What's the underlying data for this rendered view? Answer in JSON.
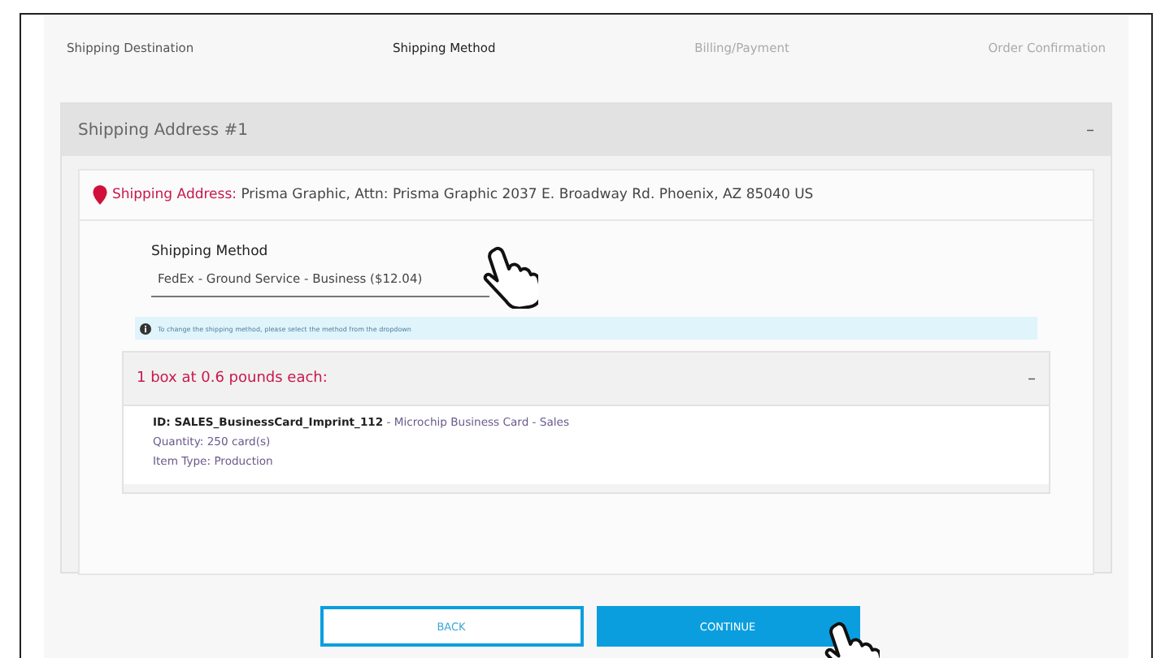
{
  "steps": [
    {
      "label": "Shipping Destination",
      "selected": false,
      "completed": true
    },
    {
      "label": "Shipping Method",
      "selected": true,
      "completed": false
    },
    {
      "label": "Billing/Payment",
      "selected": false,
      "completed": false
    },
    {
      "label": "Order Confirmation",
      "selected": false,
      "completed": false
    }
  ],
  "address_panel": {
    "title": "Shipping Address #1",
    "toggle": "–",
    "address_label": "Shipping Address:",
    "address": "Prisma Graphic, Attn: Prisma Graphic 2037 E. Broadway Rd. Phoenix, AZ 85040 US",
    "method_label": "Shipping Method",
    "method_value": "FedEx - Ground Service - Business ($12.04)",
    "info": "To change the shipping method, please select the method from the dropdown",
    "box": {
      "title": "1 box at 0.6 pounds each:",
      "toggle": "–",
      "item": "**ID: SALES_BusinessCard_Imprint_112** - Microchip Business Card - Sales",
      "quantity": "Quantity: 250 card(s)",
      "item_type": "Item Type: Production"
    }
  },
  "buttons": [
    {
      "label": "BACK",
      "kind": "outline"
    },
    {
      "label": "CONTINUE",
      "kind": "primary"
    }
  ]
}
